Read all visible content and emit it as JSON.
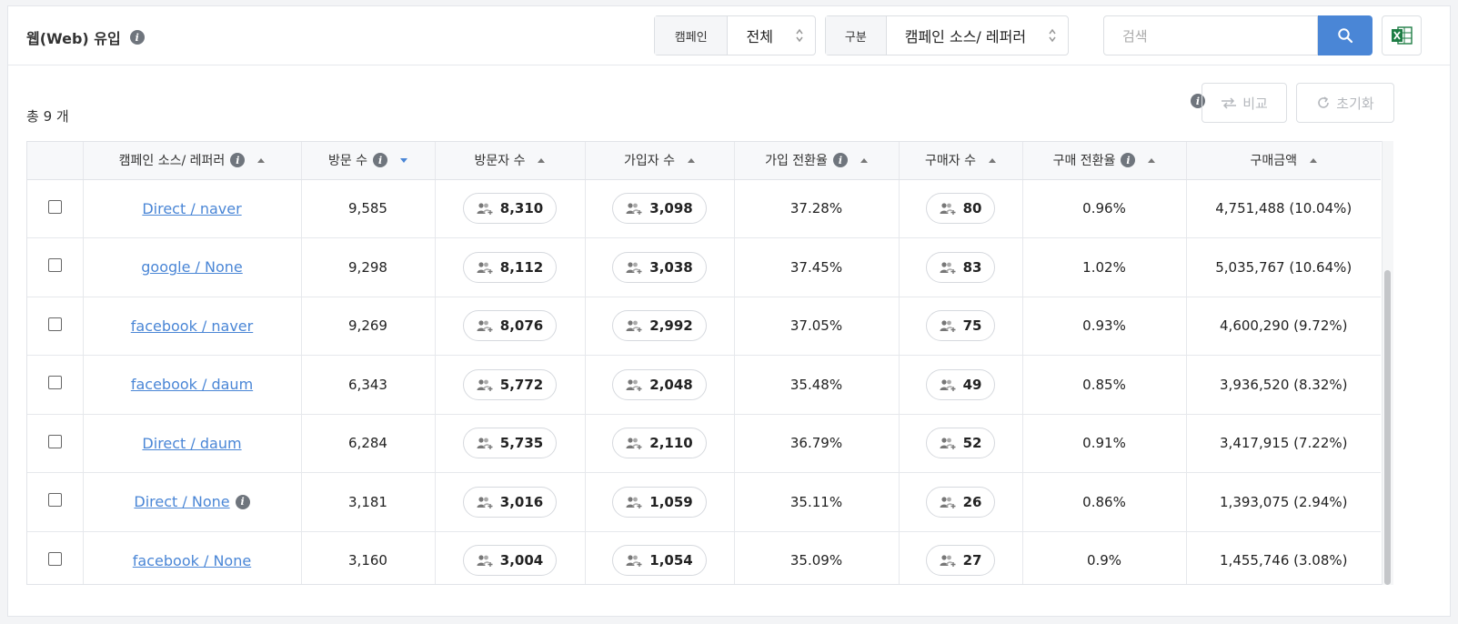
{
  "header": {
    "title": "웹(Web) 유입",
    "campaign_label": "캠페인",
    "campaign_value": "전체",
    "division_label": "구분",
    "division_value": "캠페인 소스/ 레퍼러",
    "search_placeholder": "검색"
  },
  "toolbar": {
    "total": "총 9 개",
    "compare_label": "비교",
    "reset_label": "초기화"
  },
  "table": {
    "columns": [
      "캠페인 소스/ 레퍼러",
      "방문 수",
      "방문자 수",
      "가입자 수",
      "가입 전환율",
      "구매자 수",
      "구매 전환율",
      "구매금액"
    ],
    "rows": [
      {
        "source": "Direct / naver",
        "visits": "9,585",
        "visitors": "8,310",
        "signups": "3,098",
        "signup_rate": "37.28%",
        "buyers": "80",
        "buy_rate": "0.96%",
        "amount": "4,751,488 (10.04%)"
      },
      {
        "source": "google / None",
        "visits": "9,298",
        "visitors": "8,112",
        "signups": "3,038",
        "signup_rate": "37.45%",
        "buyers": "83",
        "buy_rate": "1.02%",
        "amount": "5,035,767 (10.64%)"
      },
      {
        "source": "facebook / naver",
        "visits": "9,269",
        "visitors": "8,076",
        "signups": "2,992",
        "signup_rate": "37.05%",
        "buyers": "75",
        "buy_rate": "0.93%",
        "amount": "4,600,290 (9.72%)"
      },
      {
        "source": "facebook / daum",
        "visits": "6,343",
        "visitors": "5,772",
        "signups": "2,048",
        "signup_rate": "35.48%",
        "buyers": "49",
        "buy_rate": "0.85%",
        "amount": "3,936,520 (8.32%)"
      },
      {
        "source": "Direct / daum",
        "visits": "6,284",
        "visitors": "5,735",
        "signups": "2,110",
        "signup_rate": "36.79%",
        "buyers": "52",
        "buy_rate": "0.91%",
        "amount": "3,417,915 (7.22%)"
      },
      {
        "source": "Direct / None",
        "visits": "3,181",
        "visitors": "3,016",
        "signups": "1,059",
        "signup_rate": "35.11%",
        "buyers": "26",
        "buy_rate": "0.86%",
        "amount": "1,393,075 (2.94%)"
      },
      {
        "source": "facebook / None",
        "visits": "3,160",
        "visitors": "3,004",
        "signups": "1,054",
        "signup_rate": "35.09%",
        "buyers": "27",
        "buy_rate": "0.9%",
        "amount": "1,455,746 (3.08%)"
      }
    ]
  },
  "colors": {
    "accent": "#4a86d6",
    "excel": "#1e7d45"
  }
}
